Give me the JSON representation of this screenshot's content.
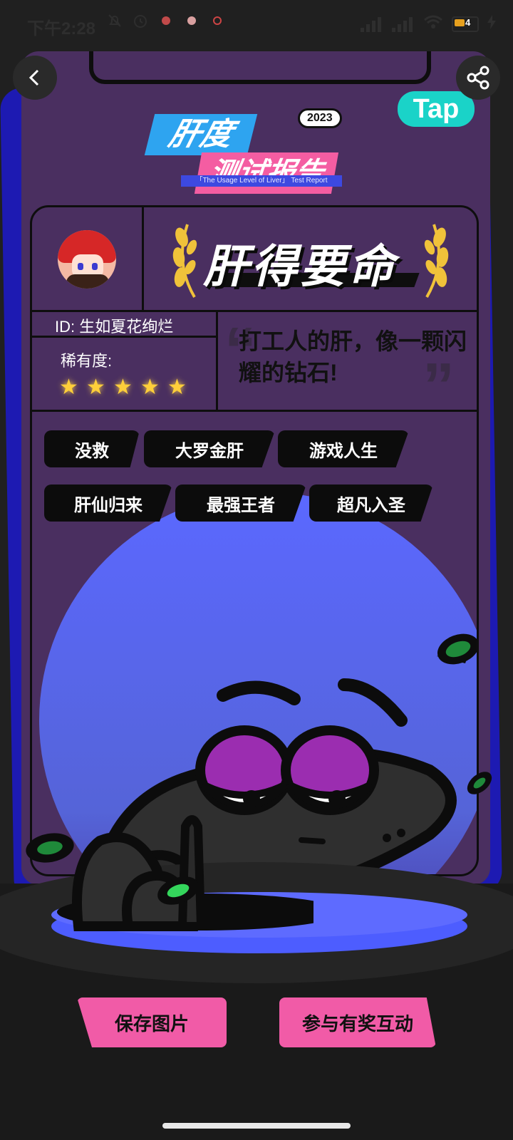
{
  "status_bar": {
    "time": "下午2:28",
    "battery_level": "4"
  },
  "report": {
    "title_top": "肝度",
    "title_bottom": "测试报告",
    "year": "2023",
    "subtitle": "「The Usage Level of Liver」 Test Report",
    "brand": "Tap",
    "rank_title": "肝得要命",
    "user_id": "ID: 生如夏花绚烂",
    "rarity_label": "稀有度:",
    "rarity_stars": 5,
    "quote": "打工人的肝，像一颗闪耀的钻石!",
    "tags": [
      "没救",
      "大罗金肝",
      "游戏人生",
      "肝仙归来",
      "最强王者",
      "超凡入圣"
    ]
  },
  "actions": {
    "save_label": "保存图片",
    "join_label": "参与有奖互动"
  },
  "colors": {
    "card_bg": "#4a2f60",
    "accent_blue": "#1d1ab2",
    "accent_pink": "#f15ba7",
    "brand_teal": "#1ad3c8",
    "moon": "#5b68ff"
  }
}
